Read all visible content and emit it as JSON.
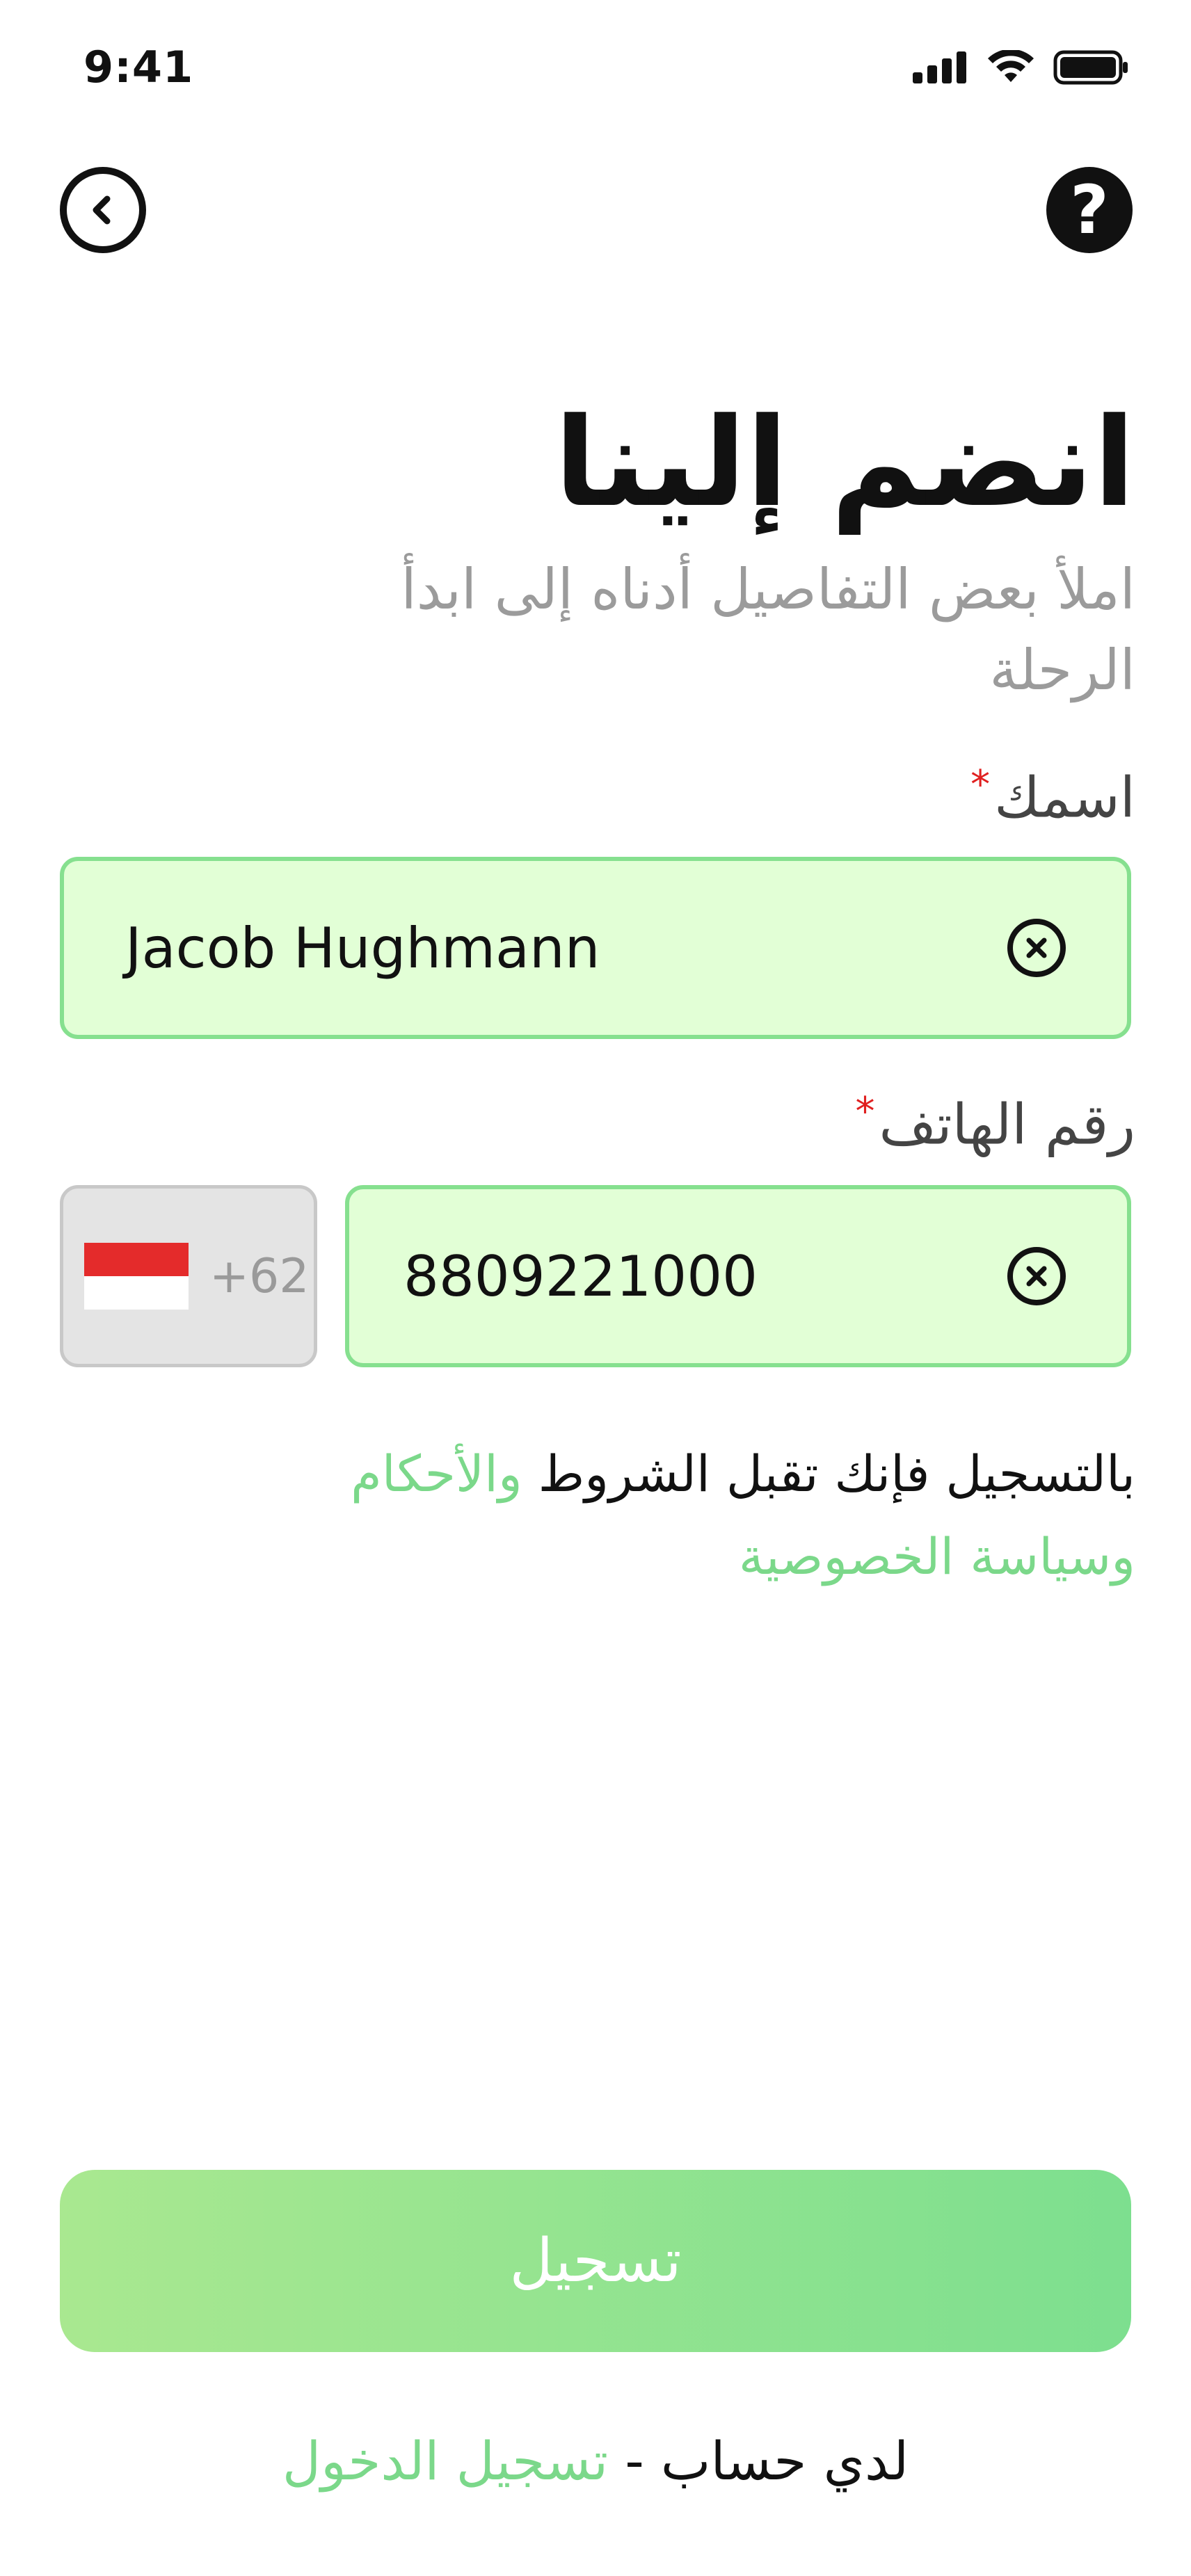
{
  "status_bar": {
    "time": "9:41",
    "icons": [
      "signal-icon",
      "wifi-icon",
      "battery-icon"
    ]
  },
  "nav": {
    "back_icon": "chevron-left-icon",
    "help_glyph": "?"
  },
  "header": {
    "title": "انضم إلينا",
    "subtitle": "املأ بعض التفاصيل أدناه إلى ابدأ الرحلة"
  },
  "form": {
    "name": {
      "label": "اسمك",
      "required_mark": "*",
      "value": "Jacob Hughmann"
    },
    "phone": {
      "label": "رقم الهاتف",
      "required_mark": "*",
      "country_code": "+62",
      "country_flag": "indonesia-flag",
      "value": "8809221000"
    }
  },
  "terms": {
    "prefix": "بالتسجيل فإنك تقبل الشروط ",
    "terms_link": "والأحكام",
    "privacy_link": "وسياسة الخصوصية"
  },
  "actions": {
    "register_label": "تسجيل"
  },
  "footer": {
    "prompt": "لدي حساب - ",
    "login_link": "تسجيل الدخول"
  },
  "colors": {
    "accent": "#7bd88a",
    "input_bg": "#e2ffd6",
    "input_border": "#86e08f",
    "required": "#e02020",
    "subtitle": "#9b9b9b"
  }
}
